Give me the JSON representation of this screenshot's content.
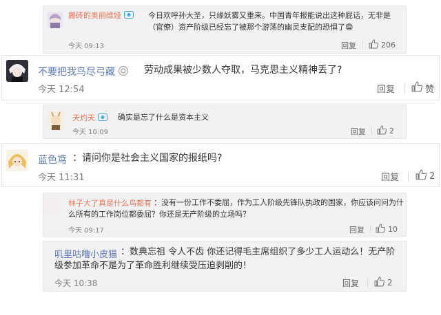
{
  "comments": [
    {
      "name": "搬砖的奥丽维娅",
      "text": "今日欢呼孙大圣，只缘妖雾又重来。中国青年报能说出这种屁话，无非是（官僚）资产阶级已经忘了被那个游荡的幽灵支配的恐惧了",
      "emoji": "😨",
      "time": "今天 09:13",
      "reply_label": "回复",
      "like_count": "206"
    },
    {
      "name": "不要把我鸟尽弓藏",
      "text": "劳动成果被少数人夺取，马克思主义精神丢了?",
      "time": "今天 12:54",
      "reply_label": "回复",
      "like_count": "赞"
    },
    {
      "name": "天灼天",
      "text": "确实是忘了什么是资本主义",
      "time": "今天 10:09",
      "reply_label": "回复",
      "like_count": "2"
    },
    {
      "name": "蓝色鸢",
      "text": "请问你是社会主义国家的报纸吗?",
      "time": "今天 11:31",
      "reply_label": "回复",
      "like_count": "2"
    },
    {
      "name": "林子大了真是什么鸟都有",
      "text": "没有一份工作不委屈，作为工人阶级先锋队执政的国家，你应该问问为什么所有的工作岗位都委屈？你还是无产阶级的立场吗？",
      "time": "今天 09:17",
      "reply_label": "回复",
      "like_count": "10"
    },
    {
      "name": "叽里咕噜小皮猫",
      "text": "数典忘祖 令人不齿 你还记得毛主席组织了多少工人运动么！无产阶级参加革命不是为了革命胜利继续受压迫剥削的！",
      "time": "今天 10:38",
      "reply_label": "回复",
      "like_count": "2"
    }
  ]
}
